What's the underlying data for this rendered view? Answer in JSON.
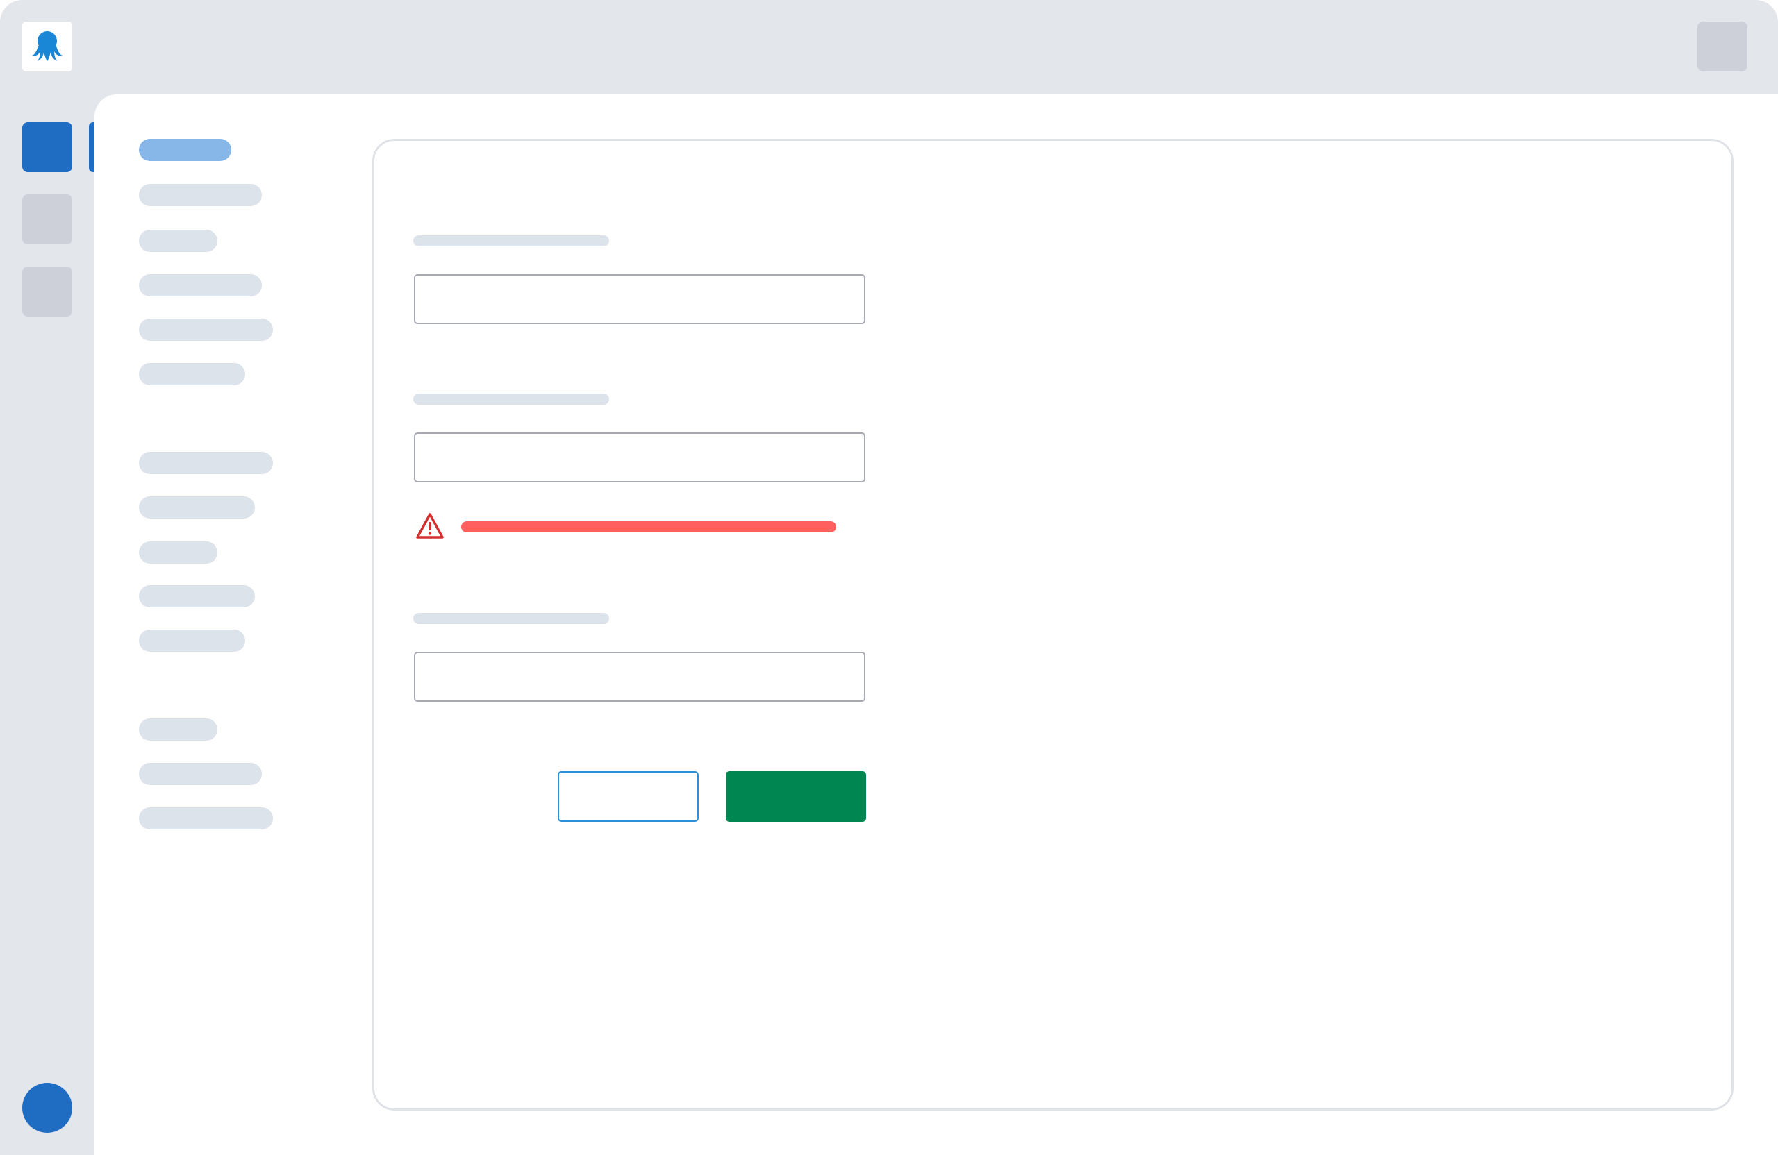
{
  "app": {
    "logo_icon": "octopus-logo-icon"
  },
  "colors": {
    "rail_background": "#e3e6eb",
    "accent_blue": "#1f6dc2",
    "nav_active": "#86b7e8",
    "placeholder_bar": "#dce3ea",
    "error_red": "#ff5f5f",
    "error_icon": "#d32f2f",
    "save_green": "#008751",
    "cancel_border": "#2d8fd6"
  },
  "rail": {
    "items": [
      {
        "icon": "rail-item-1",
        "active": true
      },
      {
        "icon": "rail-item-2",
        "active": false
      },
      {
        "icon": "rail-item-3",
        "active": false
      }
    ],
    "avatar_icon": "user-avatar"
  },
  "form": {
    "fields": [
      {
        "label": "",
        "value": "",
        "placeholder": ""
      },
      {
        "label": "",
        "value": "",
        "placeholder": "",
        "has_error": true,
        "error_message": ""
      },
      {
        "label": "",
        "value": "",
        "placeholder": ""
      }
    ],
    "error_icon": "warning-triangle-icon",
    "cancel_label": "",
    "save_label": ""
  }
}
